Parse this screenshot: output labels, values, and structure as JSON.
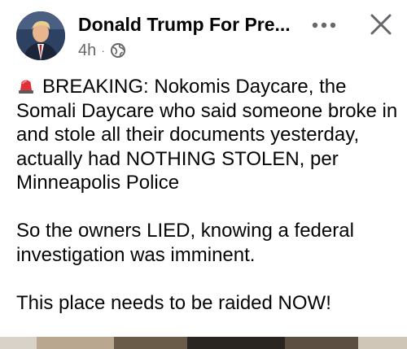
{
  "post": {
    "author": "Donald Trump For Pre...",
    "time": "4h",
    "separator": "·",
    "audience_icon": "globe-icon",
    "more_icon": "more-horizontal-icon",
    "close_icon": "close-icon",
    "breaking_icon": "siren-icon",
    "paragraph1": "BREAKING: Nokomis Daycare, the Somali Daycare who said someone broke in and stole all their documents yesterday, actually had NOTHING STOLEN, per Minneapolis Police",
    "paragraph2": "So the owners LIED, knowing a federal investigation was imminent.",
    "paragraph3": "This place needs to be raided NOW!"
  },
  "colors": {
    "text": "#050505",
    "secondary_text": "#65676b",
    "icon_gray": "#65676b",
    "siren_red": "#e0303a",
    "background": "#ffffff"
  }
}
